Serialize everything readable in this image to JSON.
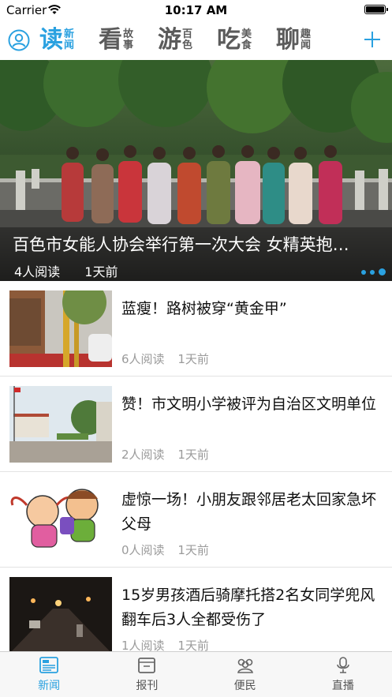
{
  "status_bar": {
    "carrier": "Carrier",
    "time": "10:17 AM"
  },
  "nav": {
    "tabs": [
      {
        "big": "读",
        "small_top": "新",
        "small_bottom": "闻",
        "active": true
      },
      {
        "big": "看",
        "small_top": "故",
        "small_bottom": "事",
        "active": false
      },
      {
        "big": "游",
        "small_top": "百",
        "small_bottom": "色",
        "active": false
      },
      {
        "big": "吃",
        "small_top": "美",
        "small_bottom": "食",
        "active": false
      },
      {
        "big": "聊",
        "small_top": "趣",
        "small_bottom": "闻",
        "active": false
      }
    ]
  },
  "hero": {
    "title": "百色市女能人协会举行第一次大会 女精英抱…",
    "reads": "4人阅读",
    "time": "1天前",
    "dots": 3,
    "active_dot": 2
  },
  "news": [
    {
      "title": "蓝瘦！路树被穿“黄金甲”",
      "reads": "6人阅读",
      "time": "1天前",
      "thumb": "street-trees"
    },
    {
      "title": "赞！市文明小学被评为自治区文明单位",
      "reads": "2人阅读",
      "time": "1天前",
      "thumb": "school-campus"
    },
    {
      "title": "虚惊一场！小朋友跟邻居老太回家急坏父母",
      "reads": "0人阅读",
      "time": "1天前",
      "thumb": "cartoon-kids"
    },
    {
      "title": "15岁男孩酒后骑摩托搭2名女同学兜风 翻车后3人全都受伤了",
      "reads": "1人阅读",
      "time": "1天前",
      "thumb": "night-road"
    }
  ],
  "tabbar": {
    "items": [
      {
        "label": "新闻",
        "icon": "newspaper-icon",
        "active": true
      },
      {
        "label": "报刊",
        "icon": "magazine-icon",
        "active": false
      },
      {
        "label": "便民",
        "icon": "people-icon",
        "active": false
      },
      {
        "label": "直播",
        "icon": "microphone-icon",
        "active": false
      }
    ]
  },
  "colors": {
    "accent": "#2aa1e0",
    "inactive_text": "#5b5b5b",
    "meta_text": "#9b9b9b"
  }
}
